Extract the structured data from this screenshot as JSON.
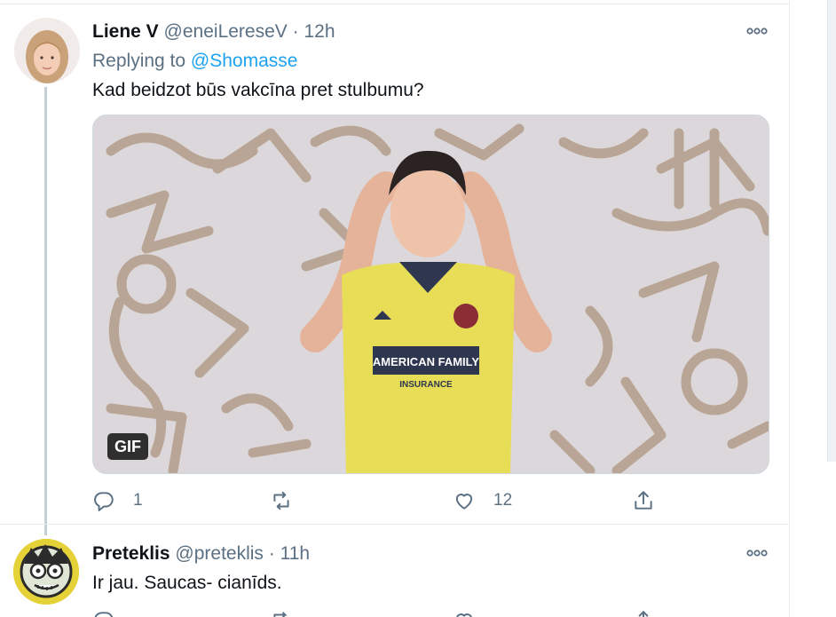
{
  "colors": {
    "accent": "#1da1f2",
    "secondary_text": "#5b7083",
    "primary_text": "#0f1419",
    "thread_line": "#c4cfd6"
  },
  "tweets": [
    {
      "name": "Liene V",
      "handle": "@eneiLereseV",
      "separator": "·",
      "time": "12h",
      "replying_prefix": "Replying to",
      "replying_to": "@Shomasse",
      "text": "Kad beidzot būs vakcīna pret stulbumu?",
      "media": {
        "badge": "GIF",
        "jersey_text_line1": "AMERICAN FAMILY",
        "jersey_text_line2": "INSURANCE"
      },
      "reply_count": "1",
      "retweet_count": "",
      "like_count": "12",
      "icons": [
        "reply-icon",
        "retweet-icon",
        "like-icon",
        "share-icon",
        "more-icon"
      ]
    },
    {
      "name": "Preteklis",
      "handle": "@preteklis",
      "separator": "·",
      "time": "11h",
      "text": "Ir jau. Saucas- cianīds.",
      "icons": [
        "reply-icon",
        "retweet-icon",
        "like-icon",
        "share-icon",
        "more-icon"
      ]
    }
  ]
}
